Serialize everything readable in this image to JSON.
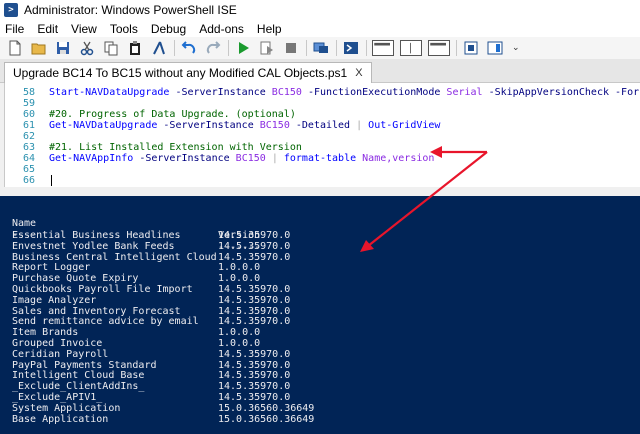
{
  "window": {
    "title": "Administrator: Windows PowerShell ISE"
  },
  "menu": [
    "File",
    "Edit",
    "View",
    "Tools",
    "Debug",
    "Add-ons",
    "Help"
  ],
  "toolbar": {
    "icons": [
      "new-file-icon",
      "open-folder-icon",
      "save-icon",
      "cut-icon",
      "copy-icon",
      "paste-icon",
      "clear-console-icon",
      "undo-icon",
      "redo-icon",
      "run-script-icon",
      "run-selection-icon",
      "stop-icon",
      "new-remote-tab-icon",
      "start-powershell-icon",
      "layout-script-top-icon",
      "layout-script-right-icon",
      "layout-script-max-icon",
      "show-commands-icon",
      "show-addon-icon"
    ]
  },
  "tab": {
    "label": "Upgrade BC14 To BC15 without any Modified CAL Objects.ps1",
    "close": "X"
  },
  "editor": {
    "lines": [
      {
        "num": "58",
        "tokens": [
          [
            "cmd",
            "Start-NAVDataUpgrade"
          ],
          [
            "txt",
            " "
          ],
          [
            "param",
            "-ServerInstance"
          ],
          [
            "txt",
            " "
          ],
          [
            "arg",
            "BC150"
          ],
          [
            "txt",
            " "
          ],
          [
            "param",
            "-FunctionExecutionMode"
          ],
          [
            "txt",
            " "
          ],
          [
            "arg",
            "Serial"
          ],
          [
            "txt",
            " "
          ],
          [
            "param",
            "-SkipAppVersionCheck"
          ],
          [
            "txt",
            " "
          ],
          [
            "param",
            "-Force"
          ]
        ]
      },
      {
        "num": "59",
        "tokens": []
      },
      {
        "num": "60",
        "tokens": [
          [
            "cmt",
            "#20. Progress of Data Upgrade. (optional)"
          ]
        ]
      },
      {
        "num": "61",
        "tokens": [
          [
            "cmd",
            "Get-NAVDataUpgrade"
          ],
          [
            "txt",
            " "
          ],
          [
            "param",
            "-ServerInstance"
          ],
          [
            "txt",
            " "
          ],
          [
            "arg",
            "BC150"
          ],
          [
            "txt",
            " "
          ],
          [
            "param",
            "-Detailed"
          ],
          [
            "txt",
            " "
          ],
          [
            "op",
            "|"
          ],
          [
            "txt",
            " "
          ],
          [
            "cmd",
            "Out-GridView"
          ]
        ]
      },
      {
        "num": "62",
        "tokens": []
      },
      {
        "num": "63",
        "tokens": [
          [
            "cmt",
            "#21. List Installed Extension with Version"
          ]
        ]
      },
      {
        "num": "64",
        "tokens": [
          [
            "cmd",
            "Get-NAVAppInfo"
          ],
          [
            "txt",
            " "
          ],
          [
            "param",
            "-ServerInstance"
          ],
          [
            "txt",
            " "
          ],
          [
            "arg",
            "BC150"
          ],
          [
            "txt",
            " "
          ],
          [
            "op",
            "|"
          ],
          [
            "txt",
            " "
          ],
          [
            "cmd",
            "format-table"
          ],
          [
            "txt",
            " "
          ],
          [
            "arg",
            "Name,version"
          ]
        ]
      },
      {
        "num": "65",
        "tokens": []
      },
      {
        "num": "66",
        "tokens": []
      }
    ]
  },
  "console": {
    "headers": {
      "name": "Name",
      "version": "Version"
    },
    "divider": {
      "name": "----",
      "version": "-------"
    },
    "rows": [
      {
        "name": "Essential Business Headlines",
        "version": "14.5.35970.0"
      },
      {
        "name": "Envestnet Yodlee Bank Feeds",
        "version": "14.5.35970.0"
      },
      {
        "name": "Business Central Intelligent Cloud",
        "version": "14.5.35970.0"
      },
      {
        "name": "Report Logger",
        "version": "1.0.0.0"
      },
      {
        "name": "Purchase Quote Expiry",
        "version": "1.0.0.0"
      },
      {
        "name": "Quickbooks Payroll File Import",
        "version": "14.5.35970.0"
      },
      {
        "name": "Image Analyzer",
        "version": "14.5.35970.0"
      },
      {
        "name": "Sales and Inventory Forecast",
        "version": "14.5.35970.0"
      },
      {
        "name": "Send remittance advice by email",
        "version": "14.5.35970.0"
      },
      {
        "name": "Item Brands",
        "version": "1.0.0.0"
      },
      {
        "name": "Grouped Invoice",
        "version": "1.0.0.0"
      },
      {
        "name": "Ceridian Payroll",
        "version": "14.5.35970.0"
      },
      {
        "name": "PayPal Payments Standard",
        "version": "14.5.35970.0"
      },
      {
        "name": "Intelligent Cloud Base",
        "version": "14.5.35970.0"
      },
      {
        "name": "_Exclude_ClientAddIns_",
        "version": "14.5.35970.0"
      },
      {
        "name": "_Exclude_APIV1_",
        "version": "14.5.35970.0"
      },
      {
        "name": "System Application",
        "version": "15.0.36560.36649"
      },
      {
        "name": "Base Application",
        "version": "15.0.36560.36649"
      }
    ]
  },
  "colors": {
    "console_bg": "#012456",
    "console_fg": "#eeedf0",
    "line_numbers": "#2b91af",
    "cmdlet": "#0000ff",
    "parameter": "#000080",
    "argument": "#8a2be2",
    "comment": "#006400",
    "arrow": "#e8152b"
  }
}
